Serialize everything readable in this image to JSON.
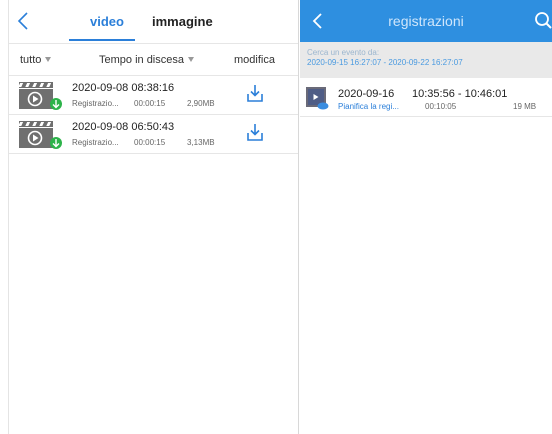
{
  "left": {
    "tabs": {
      "video": "video",
      "image": "immagine"
    },
    "filters": {
      "all": "tutto",
      "order": "Tempo in discesa",
      "edit": "modifica"
    },
    "rows": [
      {
        "date": "2020-09-08 08:38:16",
        "type": "Registrazio...",
        "duration": "00:00:15",
        "size": "2,90MB"
      },
      {
        "date": "2020-09-08 06:50:43",
        "type": "Registrazio...",
        "duration": "00:00:15",
        "size": "3,13MB"
      }
    ]
  },
  "right": {
    "title": "registrazioni",
    "range_label": "Cerca un evento da:",
    "range_value": "2020-09-15 16:27:07 - 2020-09-22 16:27:07",
    "records": [
      {
        "date": "2020-09-16",
        "time": "10:35:56 - 10:46:01",
        "type": "Pianifica la regi...",
        "duration": "00:10:05",
        "size": "19 MB"
      }
    ]
  },
  "colors": {
    "accent": "#2b7fd9",
    "header_bg": "#2e8fe0",
    "badge_green": "#2db34a"
  }
}
